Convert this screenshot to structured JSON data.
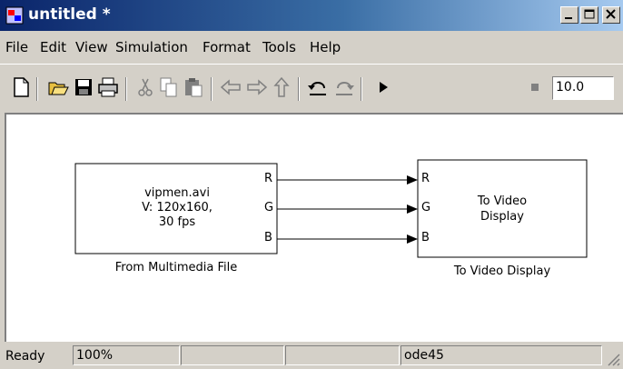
{
  "window": {
    "title": "untitled *"
  },
  "menu": {
    "items": [
      "File",
      "Edit",
      "View",
      "Simulation",
      "Format",
      "Tools",
      "Help"
    ]
  },
  "toolbar": {
    "icons": [
      "new-icon",
      "open-icon",
      "save-icon",
      "print-icon",
      "cut-icon",
      "copy-icon",
      "paste-icon",
      "back-icon",
      "forward-icon",
      "up-icon",
      "undo-icon",
      "redo-icon",
      "play-icon",
      "stop-icon"
    ],
    "stop_time": "10.0"
  },
  "model": {
    "source_block": {
      "text_lines": [
        "vipmen.avi",
        "V: 120x160,",
        "30 fps"
      ],
      "ports": [
        "R",
        "G",
        "B"
      ],
      "name": "From Multimedia File"
    },
    "sink_block": {
      "text_lines": [
        "To Video",
        "Display"
      ],
      "ports": [
        "R",
        "G",
        "B"
      ],
      "name": "To Video Display"
    }
  },
  "status": {
    "state": "Ready",
    "zoom": "100%",
    "solver": "ode45"
  },
  "colors": {
    "title_start": "#0a246a",
    "title_end": "#a6caf0",
    "chrome": "#d4d0c8"
  }
}
